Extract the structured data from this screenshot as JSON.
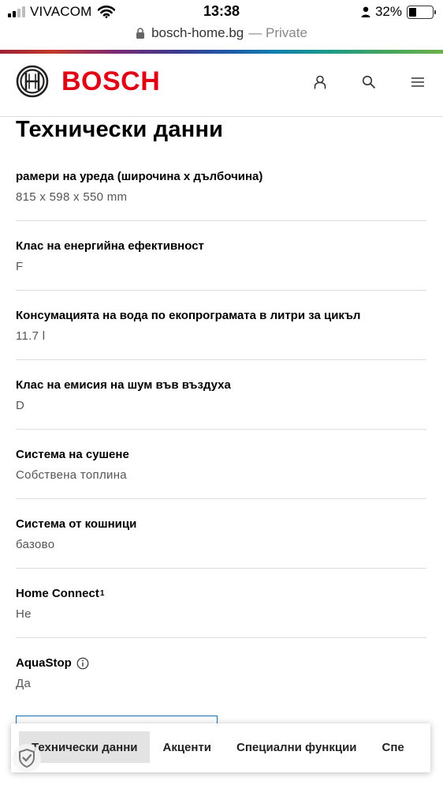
{
  "status_bar": {
    "carrier": "VIVACOM",
    "time": "13:38",
    "battery_percent": "32%",
    "battery_level": 0.32,
    "icons": [
      "signal-icon",
      "wifi-icon",
      "person-icon",
      "battery-icon"
    ]
  },
  "browser": {
    "domain": "bosch-home.bg",
    "mode": "— Private"
  },
  "header": {
    "brand": "BOSCH",
    "brand_color": "#e20015",
    "icons": [
      "user-icon",
      "search-icon",
      "menu-icon"
    ]
  },
  "page": {
    "title": "Технически данни"
  },
  "specs": [
    {
      "label": "рамери на уреда (широчина x дълбочина)",
      "value": "815 x 598 x 550 mm"
    },
    {
      "label": "Клас на енергийна ефективност",
      "value": "F"
    },
    {
      "label": "Консумацията на вода по екопрограмата в литри за цикъл",
      "value": "11.7 l"
    },
    {
      "label": "Клас на емисия на шум във въздуха",
      "value": "D"
    },
    {
      "label": "Система на сушене",
      "value": "Собствена топлина"
    },
    {
      "label": "Система от кошници",
      "value": "базово"
    },
    {
      "label": "Home Connect",
      "sup": "1",
      "value": "Не"
    },
    {
      "label": "AquaStop",
      "value": "Да",
      "icon": "info-icon"
    }
  ],
  "tabs": {
    "active": 0,
    "items": [
      "Технически данни",
      "Акценти",
      "Специални функции",
      "Спе"
    ]
  },
  "colors": {
    "accent_blue": "#1a6eb3",
    "divider": "#dcdcdc"
  }
}
